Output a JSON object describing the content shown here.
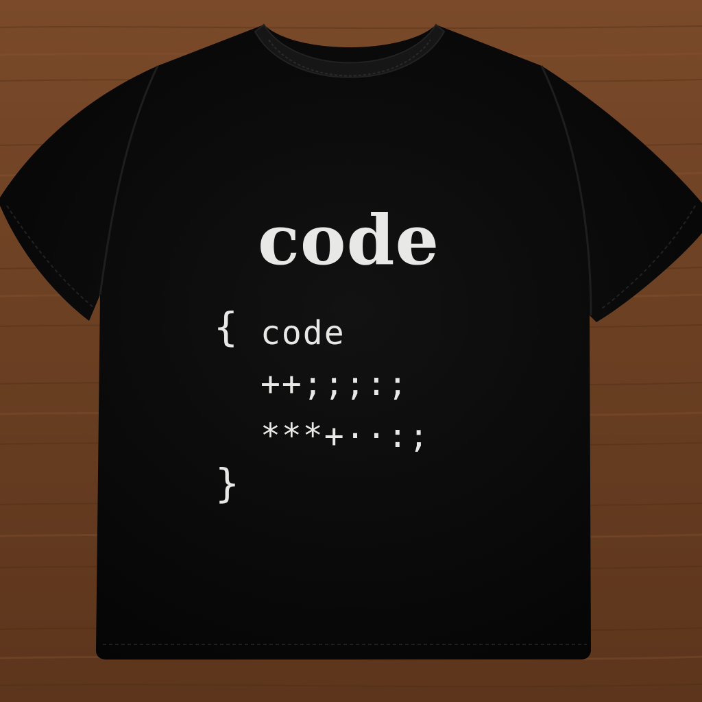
{
  "colors": {
    "wood_base": "#6a3f22",
    "wood_light": "#8a5634",
    "wood_dark": "#4a2a15",
    "shirt": "#0b0b0b",
    "shirt_seam": "#1e1e1e",
    "print_ink": "#e8e8e6"
  },
  "shirt_print": {
    "title": "code",
    "open_brace": "{",
    "lines": [
      "code",
      "++;;;:;",
      "***+··:;"
    ],
    "close_brace": "}"
  }
}
